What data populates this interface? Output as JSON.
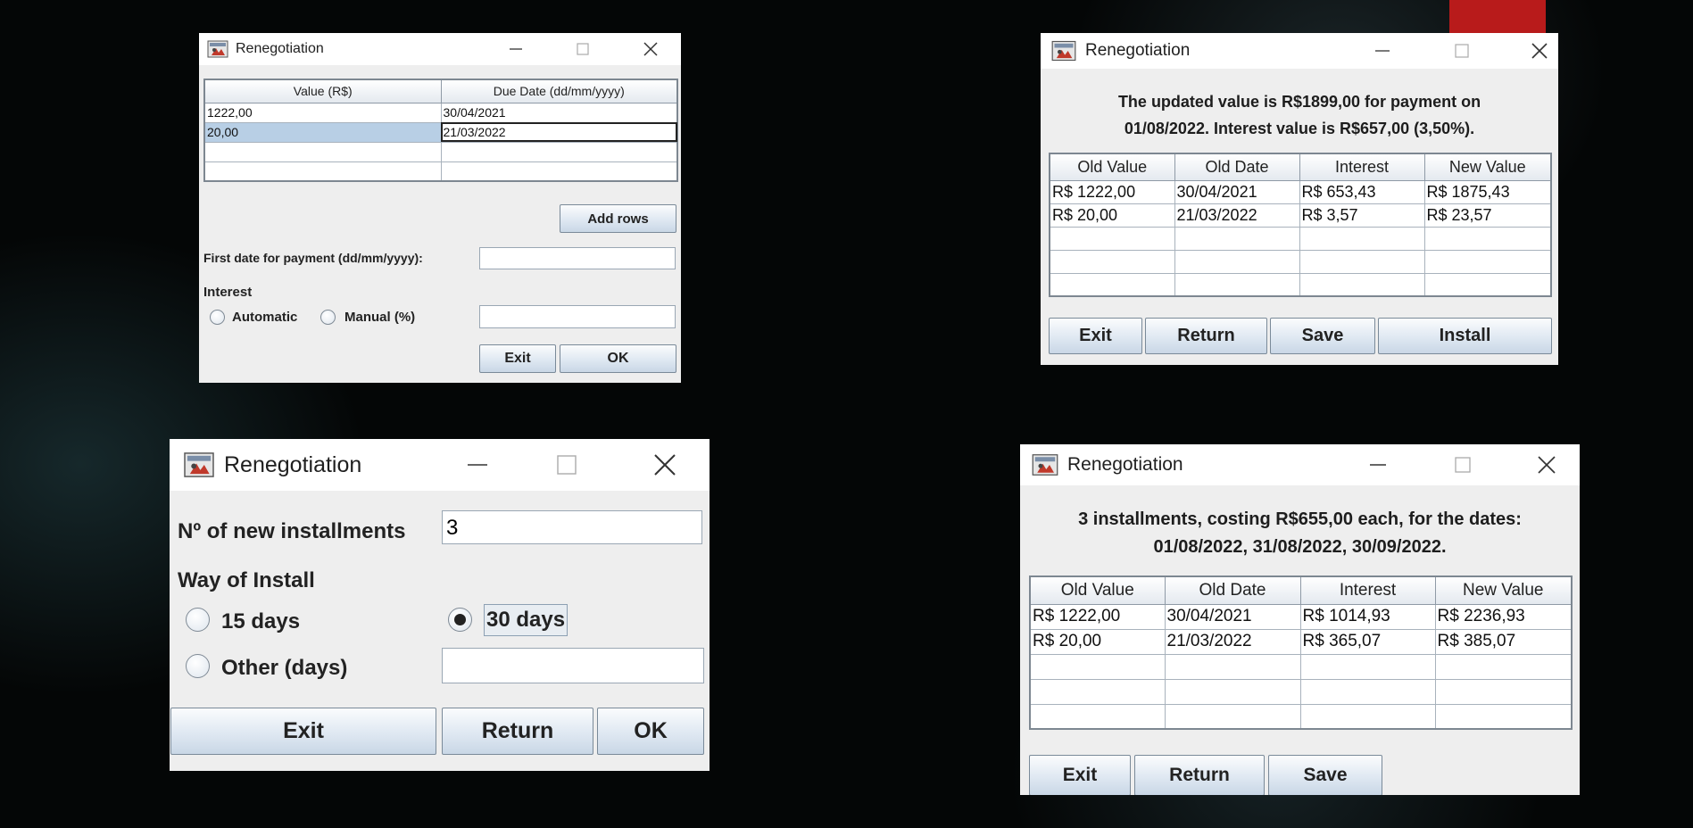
{
  "colors": {
    "window_bg": "#eeeeee",
    "title_bg": "#ffffff",
    "selection": "#b8cfe5",
    "accent_block": "#b81b1b"
  },
  "window1": {
    "title": "Renegotiation",
    "columns": [
      "Value (R$)",
      "Due Date (dd/mm/yyyy)"
    ],
    "rows": [
      [
        "1222,00",
        "30/04/2021"
      ],
      [
        "20,00",
        "21/03/2022"
      ],
      [
        "",
        ""
      ],
      [
        "",
        ""
      ],
      [
        "",
        ""
      ]
    ],
    "add_rows_label": "Add rows",
    "first_date_label": "First date for payment (dd/mm/yyyy):",
    "first_date_value": "",
    "interest_label": "Interest",
    "automatic_label": "Automatic",
    "manual_label": "Manual (%)",
    "manual_value": "",
    "exit_label": "Exit",
    "ok_label": "OK"
  },
  "window2": {
    "title": "Renegotiation",
    "message_line1": "The updated value is R$1899,00 for payment on",
    "message_line2": "01/08/2022. Interest value is R$657,00 (3,50%).",
    "columns": [
      "Old Value",
      "Old Date",
      "Interest",
      "New Value"
    ],
    "rows": [
      [
        "R$ 1222,00",
        "30/04/2021",
        "R$ 653,43",
        "R$ 1875,43"
      ],
      [
        "R$ 20,00",
        "21/03/2022",
        "R$ 3,57",
        "R$ 23,57"
      ],
      [
        "",
        "",
        "",
        ""
      ],
      [
        "",
        "",
        "",
        ""
      ],
      [
        "",
        "",
        "",
        ""
      ]
    ],
    "exit_label": "Exit",
    "return_label": "Return",
    "save_label": "Save",
    "install_label": "Install"
  },
  "window3": {
    "title": "Renegotiation",
    "installments_label": "Nº of new installments",
    "installments_value": "3",
    "way_label": "Way of Install",
    "option_15": "15 days",
    "option_30": "30 days",
    "option_other": "Other (days)",
    "other_value": "",
    "selected_option": "30 days",
    "exit_label": "Exit",
    "return_label": "Return",
    "ok_label": "OK"
  },
  "window4": {
    "title": "Renegotiation",
    "message_line1": "3 installments, costing R$655,00 each, for the dates:",
    "message_line2": "01/08/2022, 31/08/2022, 30/09/2022.",
    "columns": [
      "Old Value",
      "Old Date",
      "Interest",
      "New Value"
    ],
    "rows": [
      [
        "R$ 1222,00",
        "30/04/2021",
        "R$ 1014,93",
        "R$ 2236,93"
      ],
      [
        "R$ 20,00",
        "21/03/2022",
        "R$ 365,07",
        "R$ 385,07"
      ],
      [
        "",
        "",
        "",
        ""
      ],
      [
        "",
        "",
        "",
        ""
      ],
      [
        "",
        "",
        "",
        ""
      ]
    ],
    "exit_label": "Exit",
    "return_label": "Return",
    "save_label": "Save"
  }
}
